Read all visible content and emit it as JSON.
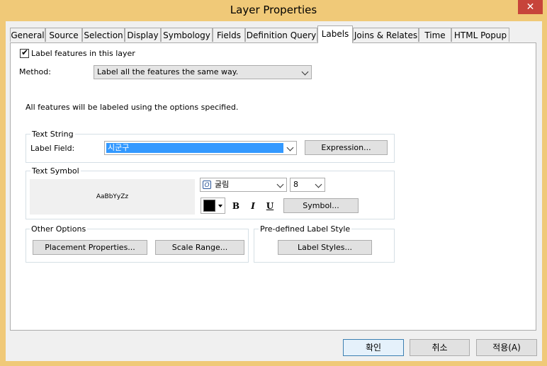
{
  "window": {
    "title": "Layer Properties",
    "close": "✕"
  },
  "tabs": [
    "General",
    "Source",
    "Selection",
    "Display",
    "Symbology",
    "Fields",
    "Definition Query",
    "Labels",
    "Joins & Relates",
    "Time",
    "HTML Popup"
  ],
  "labels_tab": {
    "label_features_checkbox": "Label features in this layer",
    "method_label": "Method:",
    "method_value": "Label all the features the same way.",
    "info_text": "All features will be labeled using the options specified.",
    "text_string": {
      "group_title": "Text String",
      "label_field_label": "Label Field:",
      "label_field_value": "시군구",
      "expression_button": "Expression..."
    },
    "text_symbol": {
      "group_title": "Text Symbol",
      "preview_text": "AaBbYyZz",
      "font_value": "굴림",
      "font_icon": "O",
      "size_value": "8",
      "bold": "B",
      "italic": "I",
      "underline": "U",
      "symbol_button": "Symbol...",
      "color": "#000000"
    },
    "other_options": {
      "group_title": "Other Options",
      "placement_button": "Placement Properties...",
      "scale_range_button": "Scale Range..."
    },
    "predefined": {
      "group_title": "Pre-defined Label Style",
      "label_styles_button": "Label Styles..."
    }
  },
  "footer": {
    "ok": "확인",
    "cancel": "취소",
    "apply": "적용(A)"
  }
}
